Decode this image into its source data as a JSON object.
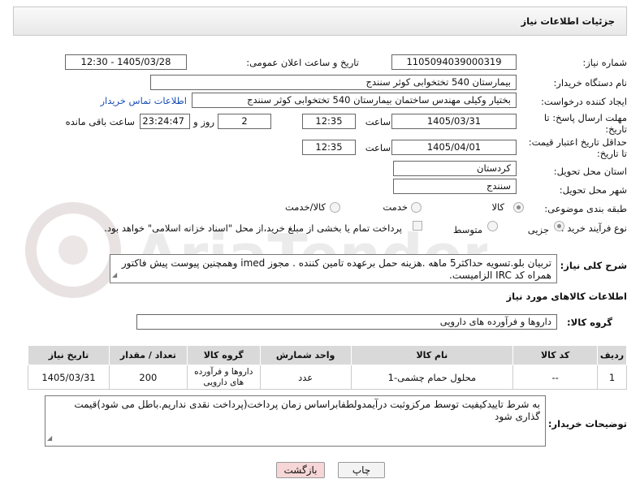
{
  "panel": {
    "title": "جزئیات اطلاعات نیاز"
  },
  "form": {
    "need_number": {
      "label": "شماره نیاز:",
      "value": "1105094039000319"
    },
    "announce_datetime": {
      "label": "تاریخ و ساعت اعلان عمومی:",
      "value": "1405/03/28 - 12:30"
    },
    "buyer_org": {
      "label": "نام دستگاه خریدار:",
      "value": "بیمارستان 540 تختخوابی کوثر سنندج"
    },
    "requester": {
      "label": "ایجاد کننده درخواست:",
      "value": "بختیار وکیلی مهندس ساختمان بیمارستان 540 تختخوابی کوثر سنندج",
      "contact_link": "اطلاعات تماس خریدار"
    },
    "reply_deadline": {
      "label_1": "مهلت ارسال پاسخ: تا",
      "label_2": "تاریخ:",
      "date": "1405/03/31",
      "time_label": "ساعت",
      "time": "12:35",
      "days": "2",
      "days_label": "روز و",
      "remaining": "23:24:47",
      "remaining_label": "ساعت باقی مانده"
    },
    "price_validity": {
      "label_1": "حداقل تاریخ اعتبار قیمت:",
      "label_2": "تا تاریخ:",
      "date": "1405/04/01",
      "time_label": "ساعت",
      "time": "12:35"
    },
    "delivery_province": {
      "label": "استان محل تحویل:",
      "value": "کردستان"
    },
    "delivery_city": {
      "label": "شهر محل تحویل:",
      "value": "سنندج"
    },
    "category": {
      "label": "طبقه بندی موضوعی:",
      "options": [
        "کالا",
        "خدمت",
        "کالا/خدمت"
      ],
      "selected": "کالا"
    },
    "process_type": {
      "label": "نوع فرآیند خرید :",
      "options": [
        "جزیی",
        "متوسط"
      ],
      "selected": "جزیی",
      "payment_note": "پرداخت تمام یا بخشی از مبلغ خرید،از محل \"اسناد خزانه اسلامی\" خواهد بود."
    }
  },
  "description": {
    "label": "شرح کلی نیاز:",
    "line1": "تربیان بلو.تسویه حداکثر5 ماهه .هزینه حمل برعهده تامین کننده . مجوز imed وهمچنین پیوست پیش فاکتور",
    "line2": "همراه کد IRC  الزامیست."
  },
  "goods_info": {
    "title": "اطلاعات کالاهای مورد نیاز",
    "group_label": "گروه کالا:",
    "group_value": "داروها و فرآورده های دارویی"
  },
  "table": {
    "headers": [
      "ردیف",
      "کد کالا",
      "نام کالا",
      "واحد شمارش",
      "گروه کالا",
      "تعداد / مقدار",
      "تاریخ نیاز"
    ],
    "rows": [
      {
        "row": "1",
        "code": "--",
        "name": "محلول حمام چشمی-1",
        "unit": "عدد",
        "group": "داروها و فرآورده های دارویی",
        "qty": "200",
        "date": "1405/03/31"
      }
    ]
  },
  "buyer_notes": {
    "label": "توضیحات خریدار:",
    "text": "به شرط تاییدکیفیت توسط مرکزوثبت درآیمدولطفابراساس زمان پرداخت(پرداخت نقدی نداریم.باطل می شود)قیمت گذاری شود"
  },
  "buttons": {
    "print": "چاپ",
    "back": "بازگشت"
  },
  "watermark": {
    "text": "AriaTender.neT"
  },
  "colors": {
    "link": "#1a4fb5",
    "back_button_bg": "#f6d6d6",
    "header_bg": "#eeeeee"
  }
}
